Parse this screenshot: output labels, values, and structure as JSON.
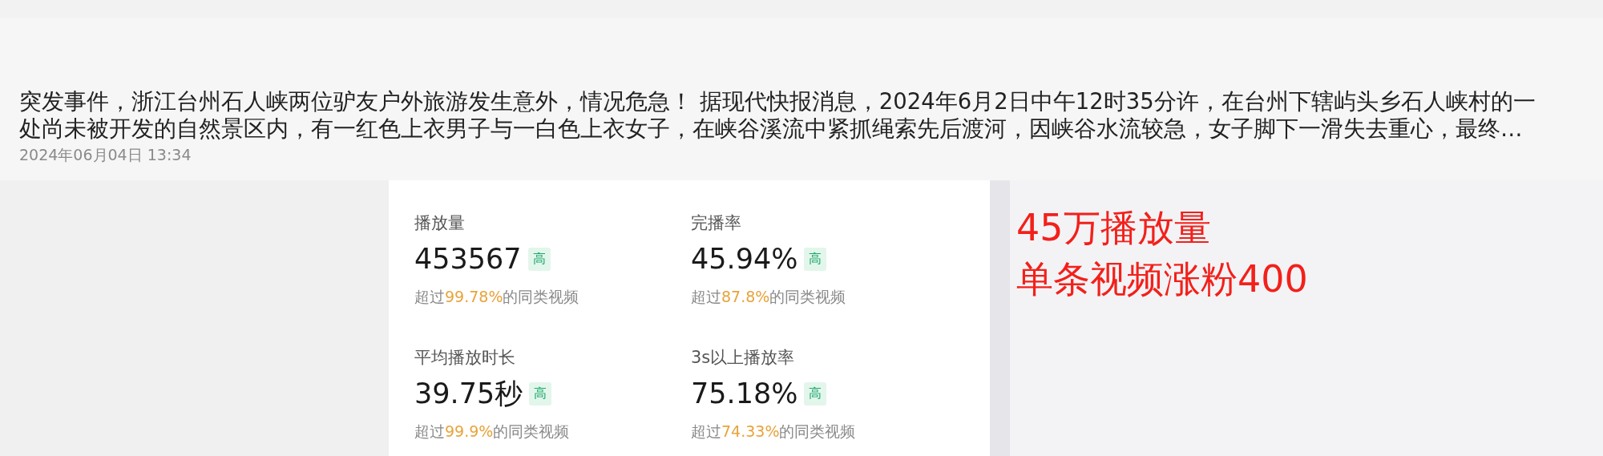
{
  "post": {
    "description_lines": [
      "突发事件，浙江台州石人峡两位驴友户外旅游发生意外，情况危急！ 据现代快报消息，2024年6月2日中午12时35分许，在台州下辖屿头乡石人峡村的一",
      "处尚未被开发的自然景区内，有一红色上衣男子与一白色上衣女子，在峡谷溪流中紧抓绳索先后渡河，因峡谷水流较急，女子脚下一滑失去重心，最终…"
    ],
    "date": "2024年06月04日 13:34"
  },
  "metrics": [
    {
      "label": "播放量",
      "value": "453567",
      "badge": "高",
      "prefix": "超过",
      "highlight": "99.78%",
      "suffix": "的同类视频"
    },
    {
      "label": "完播率",
      "value": "45.94%",
      "badge": "高",
      "prefix": "超过",
      "highlight": "87.8%",
      "suffix": "的同类视频"
    },
    {
      "label": "平均播放时长",
      "value": "39.75秒",
      "badge": "高",
      "prefix": "超过",
      "highlight": "99.9%",
      "suffix": "的同类视频"
    },
    {
      "label": "3s以上播放率",
      "value": "75.18%",
      "badge": "高",
      "prefix": "超过",
      "highlight": "74.33%",
      "suffix": "的同类视频"
    }
  ],
  "annotation": [
    "45万播放量",
    "单条视频涨粉400"
  ]
}
